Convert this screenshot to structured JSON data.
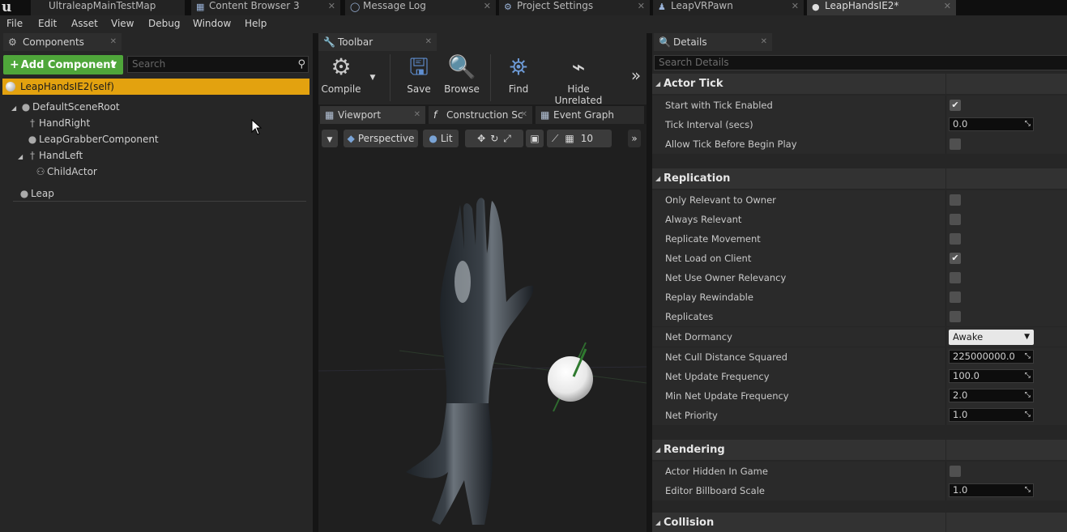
{
  "doc_tabs": [
    {
      "label": "UltraleapMainTestMap",
      "icon": "level-icon"
    },
    {
      "label": "Content Browser 3",
      "icon": "content-browser-icon"
    },
    {
      "label": "Message Log",
      "icon": "message-log-icon"
    },
    {
      "label": "Project Settings",
      "icon": "settings-icon"
    },
    {
      "label": "LeapVRPawn",
      "icon": "blueprint-icon"
    },
    {
      "label": "LeapHandsIE2*",
      "icon": "blueprint-icon"
    }
  ],
  "menu": [
    "File",
    "Edit",
    "Asset",
    "View",
    "Debug",
    "Window",
    "Help"
  ],
  "components": {
    "tab_label": "Components",
    "add_button": "Add Component",
    "search_placeholder": "Search",
    "self_label": "LeapHandsIE2(self)",
    "tree": [
      {
        "label": "DefaultSceneRoot"
      },
      {
        "label": "HandRight"
      },
      {
        "label": "LeapGrabberComponent"
      },
      {
        "label": "HandLeft"
      },
      {
        "label": "ChildActor"
      },
      {
        "label": "Leap"
      }
    ]
  },
  "toolbar": {
    "tab_label": "Toolbar",
    "buttons": [
      "Compile",
      "Save",
      "Browse",
      "Find",
      "Hide Unrelated"
    ]
  },
  "graph_tabs": [
    "Viewport",
    "Construction Sc",
    "Event Graph"
  ],
  "viewport": {
    "perspective": "Perspective",
    "lit": "Lit",
    "grid_size": "10"
  },
  "details": {
    "tab_label": "Details",
    "search_placeholder": "Search Details",
    "categories": [
      {
        "name": "Actor Tick",
        "props": [
          {
            "label": "Start with Tick Enabled",
            "type": "check",
            "checked": true
          },
          {
            "label": "Tick Interval (secs)",
            "type": "number",
            "value": "0.0"
          },
          {
            "label": "Allow Tick Before Begin Play",
            "type": "check",
            "checked": false
          }
        ]
      },
      {
        "name": "Replication",
        "props": [
          {
            "label": "Only Relevant to Owner",
            "type": "check",
            "checked": false
          },
          {
            "label": "Always Relevant",
            "type": "check",
            "checked": false
          },
          {
            "label": "Replicate Movement",
            "type": "check",
            "checked": false
          },
          {
            "label": "Net Load on Client",
            "type": "check",
            "checked": true
          },
          {
            "label": "Net Use Owner Relevancy",
            "type": "check",
            "checked": false
          },
          {
            "label": "Replay Rewindable",
            "type": "check",
            "checked": false
          },
          {
            "label": "Replicates",
            "type": "check",
            "checked": false
          },
          {
            "label": "Net Dormancy",
            "type": "combo",
            "value": "Awake"
          },
          {
            "label": "Net Cull Distance Squared",
            "type": "number",
            "value": "225000000.0"
          },
          {
            "label": "Net Update Frequency",
            "type": "number",
            "value": "100.0"
          },
          {
            "label": "Min Net Update Frequency",
            "type": "number",
            "value": "2.0"
          },
          {
            "label": "Net Priority",
            "type": "number",
            "value": "1.0"
          }
        ]
      },
      {
        "name": "Rendering",
        "props": [
          {
            "label": "Actor Hidden In Game",
            "type": "check",
            "checked": false
          },
          {
            "label": "Editor Billboard Scale",
            "type": "number",
            "value": "1.0"
          }
        ]
      },
      {
        "name": "Collision",
        "props": []
      }
    ]
  },
  "colors": {
    "accent_selection": "#e3a20f",
    "add_component_green": "#4fa63a"
  }
}
